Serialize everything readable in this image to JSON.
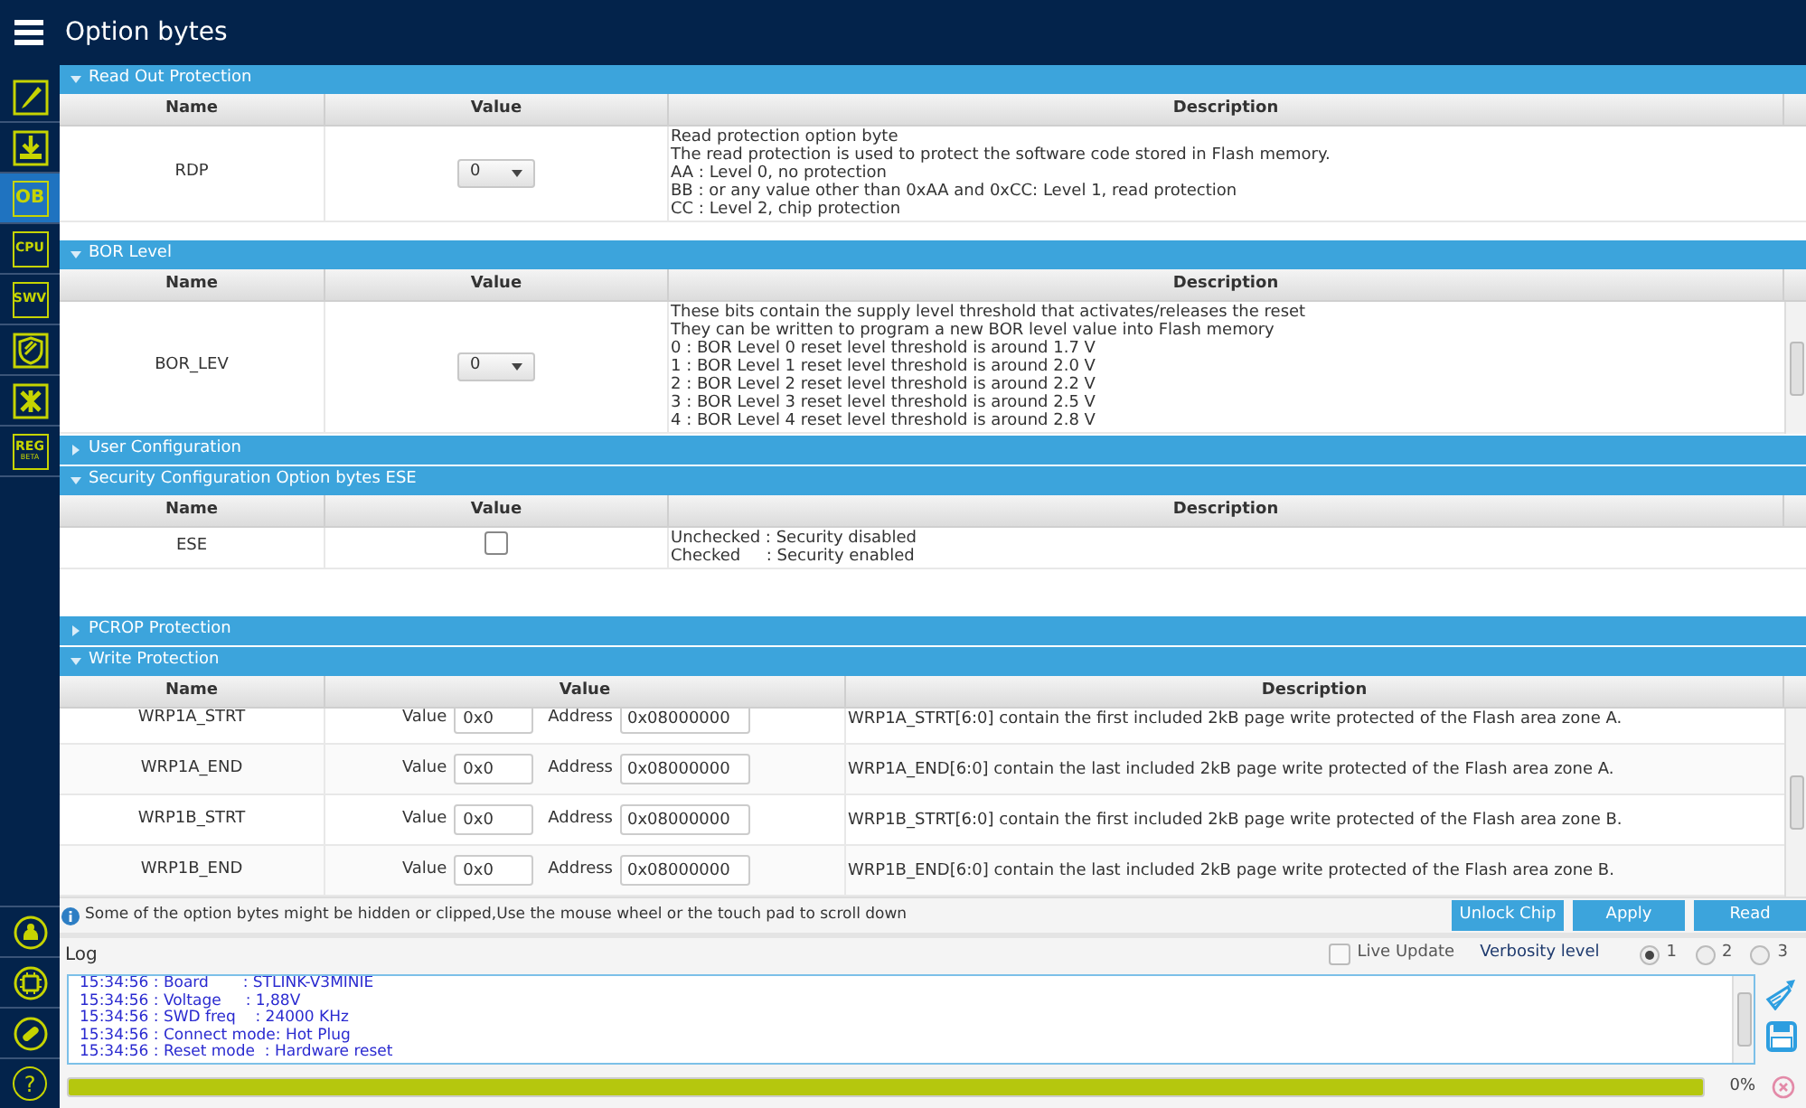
{
  "header": {
    "title": "Option bytes"
  },
  "sidebar": {
    "items": [
      {
        "selected": false
      },
      {
        "selected": false
      },
      {
        "label": "OB",
        "selected": true
      },
      {
        "label": "CPU",
        "selected": false
      },
      {
        "label": "SWV",
        "selected": false
      },
      {
        "selected": false
      },
      {
        "selected": false
      },
      {
        "label": "REG",
        "sublabel": "BETA",
        "selected": false
      }
    ],
    "help": {
      "label": "?"
    }
  },
  "sections": [
    {
      "title": "Read Out Protection",
      "expanded": true,
      "columns": [
        "Name",
        "Value",
        "Description"
      ],
      "rows": [
        {
          "kind": "dropdown",
          "name": "RDP",
          "value": "0",
          "description": [
            "Read protection option byte",
            "The read protection is used to protect the software code stored in Flash memory.",
            "AA : Level 0, no protection",
            "BB : or any value other than 0xAA and 0xCC: Level 1, read protection",
            "CC : Level 2, chip protection"
          ]
        }
      ]
    },
    {
      "title": "BOR Level",
      "expanded": true,
      "columns": [
        "Name",
        "Value",
        "Description"
      ],
      "rows": [
        {
          "kind": "dropdown",
          "name": "BOR_LEV",
          "value": "0",
          "description": [
            "These bits contain the supply level threshold that activates/releases the reset",
            "They can be written to program a new BOR level value into Flash memory",
            "0 : BOR Level 0 reset level threshold is around 1.7 V",
            "1 : BOR Level 1 reset level threshold is around 2.0 V",
            "2 : BOR Level 2 reset level threshold is around 2.2 V",
            "3 : BOR Level 3 reset level threshold is around 2.5 V",
            "4 : BOR Level 4 reset level threshold is around 2.8 V"
          ]
        }
      ]
    },
    {
      "title": "User Configuration",
      "expanded": false
    },
    {
      "title": "Security Configuration Option bytes ESE",
      "expanded": true,
      "columns": [
        "Name",
        "Value",
        "Description"
      ],
      "rows": [
        {
          "kind": "checkbox",
          "name": "ESE",
          "checked": false,
          "description": [
            "Unchecked : Security disabled",
            "Checked     : Security enabled"
          ]
        }
      ]
    },
    {
      "title": "PCROP Protection",
      "expanded": false
    },
    {
      "title": "Write Protection",
      "expanded": true,
      "columns": [
        "Name",
        "Value",
        "Description"
      ],
      "rows": [
        {
          "kind": "wrp",
          "name": "WRP1A_STRT",
          "value_label": "Value",
          "value": "0x0",
          "address_label": "Address",
          "address": "0x08000000",
          "description": [
            "WRP1A_STRT[6:0] contain the first included 2kB page write protected of the Flash area zone A."
          ]
        },
        {
          "kind": "wrp",
          "name": "WRP1A_END",
          "value_label": "Value",
          "value": "0x0",
          "address_label": "Address",
          "address": "0x08000000",
          "description": [
            "WRP1A_END[6:0] contain the last included 2kB page write protected of the Flash area zone A."
          ]
        },
        {
          "kind": "wrp",
          "name": "WRP1B_STRT",
          "value_label": "Value",
          "value": "0x0",
          "address_label": "Address",
          "address": "0x08000000",
          "description": [
            "WRP1B_STRT[6:0] contain the first included 2kB page write protected of the Flash area zone B."
          ]
        },
        {
          "kind": "wrp",
          "name": "WRP1B_END",
          "value_label": "Value",
          "value": "0x0",
          "address_label": "Address",
          "address": "0x08000000",
          "description": [
            "WRP1B_END[6:0] contain the last included 2kB page write protected of the Flash area zone B."
          ]
        }
      ]
    }
  ],
  "info": {
    "text": "Some of the option bytes might be hidden or clipped,Use the mouse wheel or the touch pad to scroll down"
  },
  "buttons": [
    "Unlock Chip",
    "Apply",
    "Read"
  ],
  "log": {
    "title": "Log",
    "live_update": {
      "label": "Live Update",
      "checked": false
    },
    "verbosity_label": "Verbosity level",
    "verbosity": [
      {
        "label": "1",
        "selected": true
      },
      {
        "label": "2",
        "selected": false
      },
      {
        "label": "3",
        "selected": false
      }
    ],
    "lines": [
      "15:34:56 : Board       : STLINK-V3MINIE",
      "15:34:56 : Voltage     : 1,88V",
      "15:34:56 : SWD freq    : 24000 KHz",
      "15:34:56 : Connect mode: Hot Plug",
      "15:34:56 : Reset mode  : Hardware reset"
    ]
  },
  "progress": {
    "level": 1,
    "reading": "0%"
  }
}
